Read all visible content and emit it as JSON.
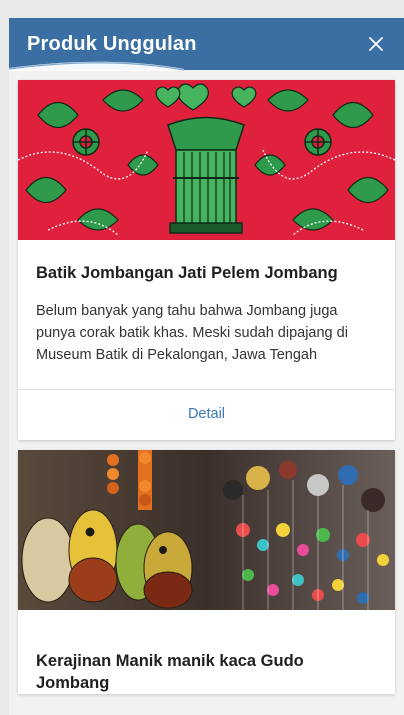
{
  "header": {
    "title": "Produk Unggulan",
    "close_label": "×"
  },
  "products": [
    {
      "title": "Batik Jombangan Jati Pelem Jombang",
      "description": "Belum banyak yang tahu bahwa Jombang juga punya corak batik khas. Meski sudah dipajang di Museum Batik di Pekalongan, Jawa Tengah",
      "action_label": "Detail"
    },
    {
      "title": "Kerajinan Manik manik kaca Gudo Jombang"
    }
  ],
  "colors": {
    "header_bg": "#3b6fa3",
    "link": "#3b78b5",
    "batik_red": "#e0213d",
    "batik_green": "#2f9a4c"
  }
}
